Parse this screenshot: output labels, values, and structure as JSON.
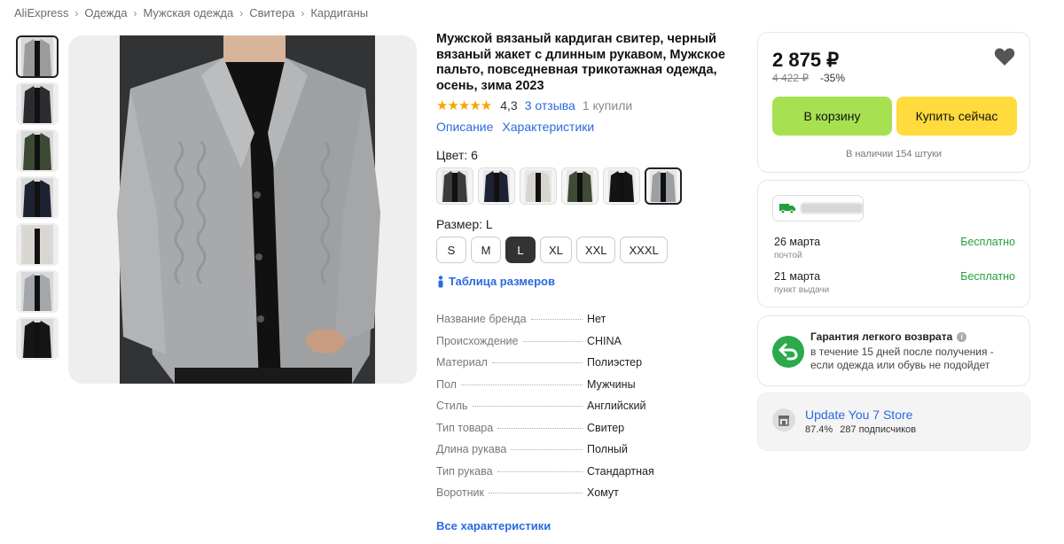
{
  "breadcrumb": [
    "AliExpress",
    "Одежда",
    "Мужская одежда",
    "Свитера",
    "Кардиганы"
  ],
  "product": {
    "title": "Мужской вязаный кардиган свитер, черный вязаный жакет с длинным рукавом, Мужское пальто, повседневная трикотажная одежда, осень, зима 2023",
    "rating": "4,3",
    "rating_value": 4.3,
    "reviews": "3 отзыва",
    "bought": "1 купили",
    "tab_description": "Описание",
    "tab_specs": "Характеристики"
  },
  "thumbnails": [
    {
      "color": "#9a9b9d",
      "active": true
    },
    {
      "color": "#2a2c2f"
    },
    {
      "color": "#3d4a33"
    },
    {
      "color": "#1d2233"
    },
    {
      "color": "#d9d6cf"
    },
    {
      "color": "#a3a6aa"
    },
    {
      "color": "#151515"
    }
  ],
  "color": {
    "label": "Цвет: 6",
    "options": [
      {
        "color": "#3b3d3c"
      },
      {
        "color": "#1c2133"
      },
      {
        "color": "#d8d5ce"
      },
      {
        "color": "#3f4b35"
      },
      {
        "color": "#141414"
      },
      {
        "color": "#9c9fa3",
        "active": true
      }
    ]
  },
  "size": {
    "label": "Размер: L",
    "options": [
      "S",
      "M",
      "L",
      "XL",
      "XXL",
      "XXXL"
    ],
    "selected": "L",
    "table_link": "Таблица размеров"
  },
  "specs": [
    {
      "k": "Название бренда",
      "v": "Нет"
    },
    {
      "k": "Происхождение",
      "v": "CHINA"
    },
    {
      "k": "Материал",
      "v": "Полиэстер"
    },
    {
      "k": "Пол",
      "v": "Мужчины"
    },
    {
      "k": "Стиль",
      "v": "Английский"
    },
    {
      "k": "Тип товара",
      "v": "Свитер"
    },
    {
      "k": "Длина рукава",
      "v": "Полный"
    },
    {
      "k": "Тип рукава",
      "v": "Стандартная"
    },
    {
      "k": "Воротник",
      "v": "Хомут"
    }
  ],
  "all_specs": "Все характеристики",
  "price": {
    "current": "2 875 ₽",
    "old": "4 422 ₽",
    "discount": "-35%",
    "cart_button": "В корзину",
    "buy_button": "Купить сейчас",
    "stock": "В наличии 154 штуки"
  },
  "delivery": [
    {
      "date": "26 марта",
      "method": "почтой",
      "price": "Бесплатно"
    },
    {
      "date": "21 марта",
      "method": "пункт выдачи",
      "price": "Бесплатно"
    }
  ],
  "return": {
    "title": "Гарантия легкого возврата",
    "text": "в течение 15 дней после получения - если одежда или обувь не подойдет"
  },
  "store": {
    "name": "Update You 7 Store",
    "rating": "87.4%",
    "followers": "287 подписчиков"
  },
  "colors": {
    "link": "#2a6ae0",
    "cart": "#a7e152",
    "buy": "#ffdb3d",
    "free": "#23a03d",
    "star": "#f7a500"
  }
}
